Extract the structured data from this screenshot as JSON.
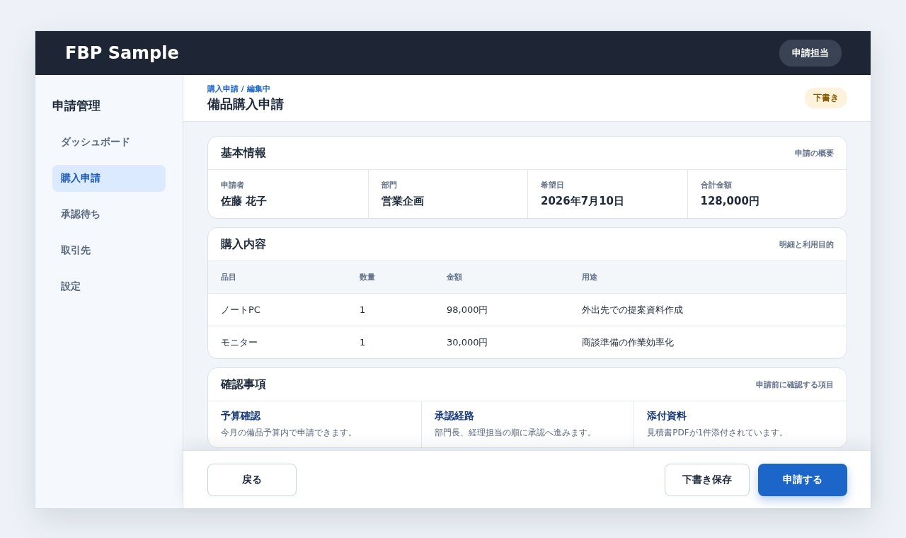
{
  "app": {
    "title": "FBP Sample",
    "role_badge": "申請担当"
  },
  "sidebar": {
    "title": "申請管理",
    "items": [
      {
        "label": "ダッシュボード",
        "selected": false
      },
      {
        "label": "購入申請",
        "selected": true
      },
      {
        "label": "承認待ち",
        "selected": false
      },
      {
        "label": "取引先",
        "selected": false
      },
      {
        "label": "設定",
        "selected": false
      }
    ]
  },
  "page": {
    "breadcrumb": "購入申請 / 編集中",
    "title": "備品購入申請",
    "status": "下書き"
  },
  "basic_info": {
    "title": "基本情報",
    "note": "申請の概要",
    "fields": [
      {
        "label": "申請者",
        "value": "佐藤 花子"
      },
      {
        "label": "部門",
        "value": "営業企画"
      },
      {
        "label": "希望日",
        "value": "2026年7月10日"
      },
      {
        "label": "合計金額",
        "value": "128,000円"
      }
    ]
  },
  "purchase": {
    "title": "購入内容",
    "note": "明細と利用目的",
    "columns": [
      "品目",
      "数量",
      "金額",
      "用途"
    ],
    "rows": [
      [
        "ノートPC",
        "1",
        "98,000円",
        "外出先での提案資料作成"
      ],
      [
        "モニター",
        "1",
        "30,000円",
        "商談準備の作業効率化"
      ]
    ]
  },
  "checks": {
    "title": "確認事項",
    "note": "申請前に確認する項目",
    "items": [
      {
        "title": "予算確認",
        "text": "今月の備品予算内で申請できます。"
      },
      {
        "title": "承認経路",
        "text": "部門長、経理担当の順に承認へ進みます。"
      },
      {
        "title": "添付資料",
        "text": "見積書PDFが1件添付されています。"
      }
    ]
  },
  "footer": {
    "buttons": [
      {
        "label": "戻る",
        "kind": "secondary"
      },
      {
        "label": "下書き保存",
        "kind": "secondary"
      },
      {
        "label": "申請する",
        "kind": "primary"
      }
    ]
  }
}
